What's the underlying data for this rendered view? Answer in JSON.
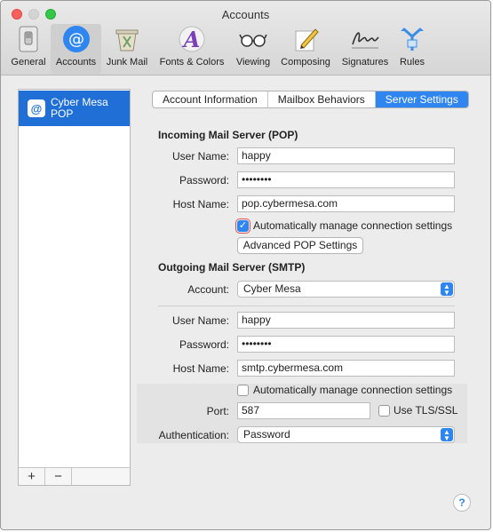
{
  "window": {
    "title": "Accounts"
  },
  "toolbar": {
    "items": [
      {
        "label": "General"
      },
      {
        "label": "Accounts"
      },
      {
        "label": "Junk Mail"
      },
      {
        "label": "Fonts & Colors"
      },
      {
        "label": "Viewing"
      },
      {
        "label": "Composing"
      },
      {
        "label": "Signatures"
      },
      {
        "label": "Rules"
      }
    ],
    "selected": "Accounts"
  },
  "sidebar": {
    "account": {
      "name": "Cyber Mesa",
      "type": "POP",
      "icon": "at-icon"
    },
    "add_label": "+",
    "remove_label": "−"
  },
  "tabs": [
    {
      "label": "Account Information"
    },
    {
      "label": "Mailbox Behaviors"
    },
    {
      "label": "Server Settings"
    }
  ],
  "active_tab": "Server Settings",
  "incoming": {
    "heading": "Incoming Mail Server (POP)",
    "user_label": "User Name:",
    "user_value": "happy",
    "password_label": "Password:",
    "password_value": "••••••••",
    "host_label": "Host Name:",
    "host_value": "pop.cybermesa.com",
    "auto_label": "Automatically manage connection settings",
    "auto_checked": true,
    "advanced_button": "Advanced POP Settings"
  },
  "outgoing": {
    "heading": "Outgoing Mail Server (SMTP)",
    "account_label": "Account:",
    "account_value": "Cyber Mesa",
    "user_label": "User Name:",
    "user_value": "happy",
    "password_label": "Password:",
    "password_value": "••••••••",
    "host_label": "Host Name:",
    "host_value": "smtp.cybermesa.com",
    "auto_label": "Automatically manage connection settings",
    "auto_checked": false,
    "port_label": "Port:",
    "port_value": "587",
    "tls_label": "Use TLS/SSL",
    "tls_checked": false,
    "auth_label": "Authentication:",
    "auth_value": "Password"
  },
  "help_label": "?",
  "colors": {
    "accent": "#2f86f0",
    "selection": "#1f6fd6"
  }
}
